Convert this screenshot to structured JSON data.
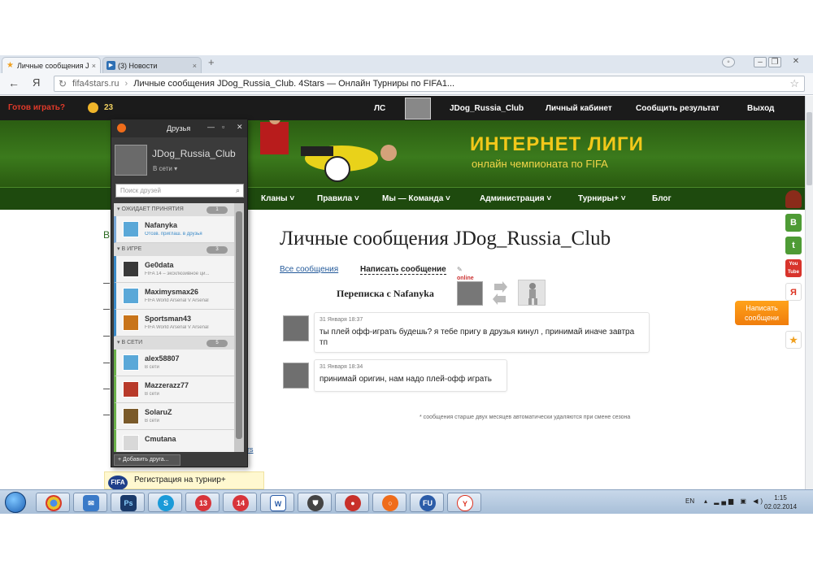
{
  "browser": {
    "tabs": [
      {
        "label": "Личные сообщения J",
        "active": true
      },
      {
        "label": "(3) Новости",
        "active": false
      }
    ],
    "address": {
      "host": "fifa4stars.ru",
      "separator": "›",
      "title": "Личные сообщения JDog_Russia_Club. 4Stars — Онлайн Турниры по FIFA1..."
    }
  },
  "site": {
    "ready_label": "Готов играть?",
    "coins": "23",
    "top_links": {
      "ls": "ЛС",
      "user": "JDog_Russia_Club",
      "cabinet": "Личный кабинет",
      "report": "Сообщить результат",
      "logout": "Выход"
    },
    "banner": {
      "title": "ИНТЕРНЕТ ЛИГИ",
      "subtitle": "онлайн чемпионата по FIFA"
    },
    "menu": [
      "Кланы ˅",
      "Правила ˅",
      "Мы — Команда ˅",
      "Администрация ˅",
      "Турниры+ ˅",
      "Блог"
    ]
  },
  "page": {
    "title": "Личные сообщения JDog_Russia_Club",
    "all_messages": "Все сообщения",
    "write_message": "Написать сообщение",
    "conversation_title": "Переписка с Nafanyka",
    "online_label": "online",
    "messages": [
      {
        "date": "31 Января 18:37",
        "text": "ты плей офф-играть будешь? я тебе пригу в друзья кинул , принимай иначе завтра тп"
      },
      {
        "date": "31 Января 18:34",
        "text": "принимай оригин, нам надо плей-офф играть"
      }
    ],
    "note": "* сообщения старше двух месяцев автоматически удаляются при смене сезона",
    "left_letter": "В",
    "rs_link": "rs",
    "registration": "Регистрация на турнир+",
    "write_tab": "Написать сообщени"
  },
  "social": [
    "В",
    "t",
    "You Tube",
    "Я"
  ],
  "friends": {
    "title": "Друзья",
    "me": {
      "name": "JDog_Russia_Club",
      "status": "В сети ▾"
    },
    "search_placeholder": "Поиск друзей",
    "sections": [
      {
        "title": "ОЖИДАЕТ ПРИНЯТИЯ",
        "count": "1",
        "items": [
          {
            "name": "Nafanyka",
            "sub": "Отозв. приглаш. в друзья",
            "color": "#5aa8d8"
          }
        ]
      },
      {
        "title": "В ИГРЕ",
        "count": "3",
        "items": [
          {
            "name": "Ge0data",
            "sub": "FIFA 14 – эксклюзивное ци...",
            "color": "#3a3a3a"
          },
          {
            "name": "Maximysmax26",
            "sub": "FIFA World Arsenal V Arsenal",
            "color": "#5aa8d8"
          },
          {
            "name": "Sportsman43",
            "sub": "FIFA World Arsenal V Arsenal",
            "color": "#c8741a"
          }
        ]
      },
      {
        "title": "В СЕТИ",
        "count": "5",
        "items": [
          {
            "name": "alex58807",
            "sub": "В сети",
            "color": "#5aa8d8"
          },
          {
            "name": "Mazzerazz77",
            "sub": "В сети",
            "color": "#b83a2a"
          },
          {
            "name": "SolaruZ",
            "sub": "В сети",
            "color": "#7a5a2a"
          },
          {
            "name": "Cmutana",
            "sub": "",
            "color": "#d8d8d8"
          }
        ]
      }
    ],
    "add_friend": "+ Добавить друга..."
  },
  "taskbar": {
    "lang": "EN",
    "time": "1:15",
    "date": "02.02.2014"
  }
}
